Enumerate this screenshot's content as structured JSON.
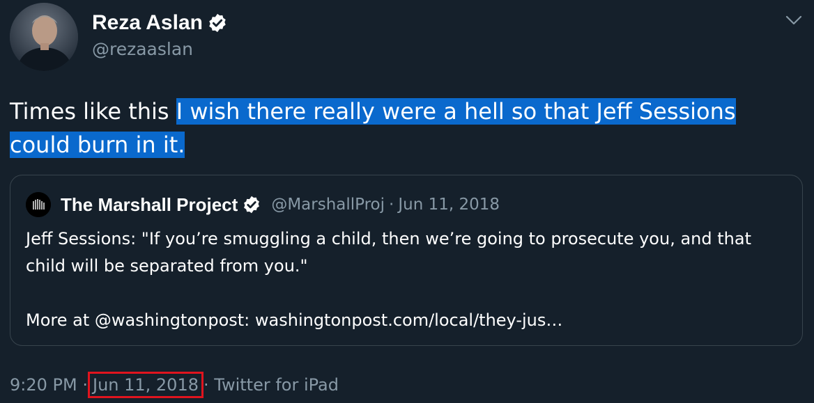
{
  "author": {
    "display_name": "Reza Aslan",
    "handle": "@rezaaslan",
    "verified_icon": "verified-badge-icon",
    "avatar_icon": "profile-photo"
  },
  "tweet": {
    "text_plain": "Times like this ",
    "text_highlighted": "I wish there really were a hell so that Jeff Sessions could burn in it."
  },
  "quoted_tweet": {
    "display_name": "The Marshall Project",
    "handle": "@MarshallProj",
    "separator": "·",
    "date": "Jun 11, 2018",
    "body_line1": "Jeff Sessions: \"If you’re smuggling a child, then we’re going to prosecute you, and that child will be separated from you.\"",
    "body_line2": "More at @washingtonpost: washingtonpost.com/local/they-jus…"
  },
  "footer": {
    "time": "9:20 PM",
    "separator_1": "·",
    "date": "Jun 11, 2018",
    "separator_2": "·",
    "source": "Twitter for iPad"
  },
  "colors": {
    "background": "#15202b",
    "secondary_text": "#8899a6",
    "highlight": "#0a69cd",
    "annotation_box": "#e0141e",
    "quote_border": "#38444d"
  }
}
